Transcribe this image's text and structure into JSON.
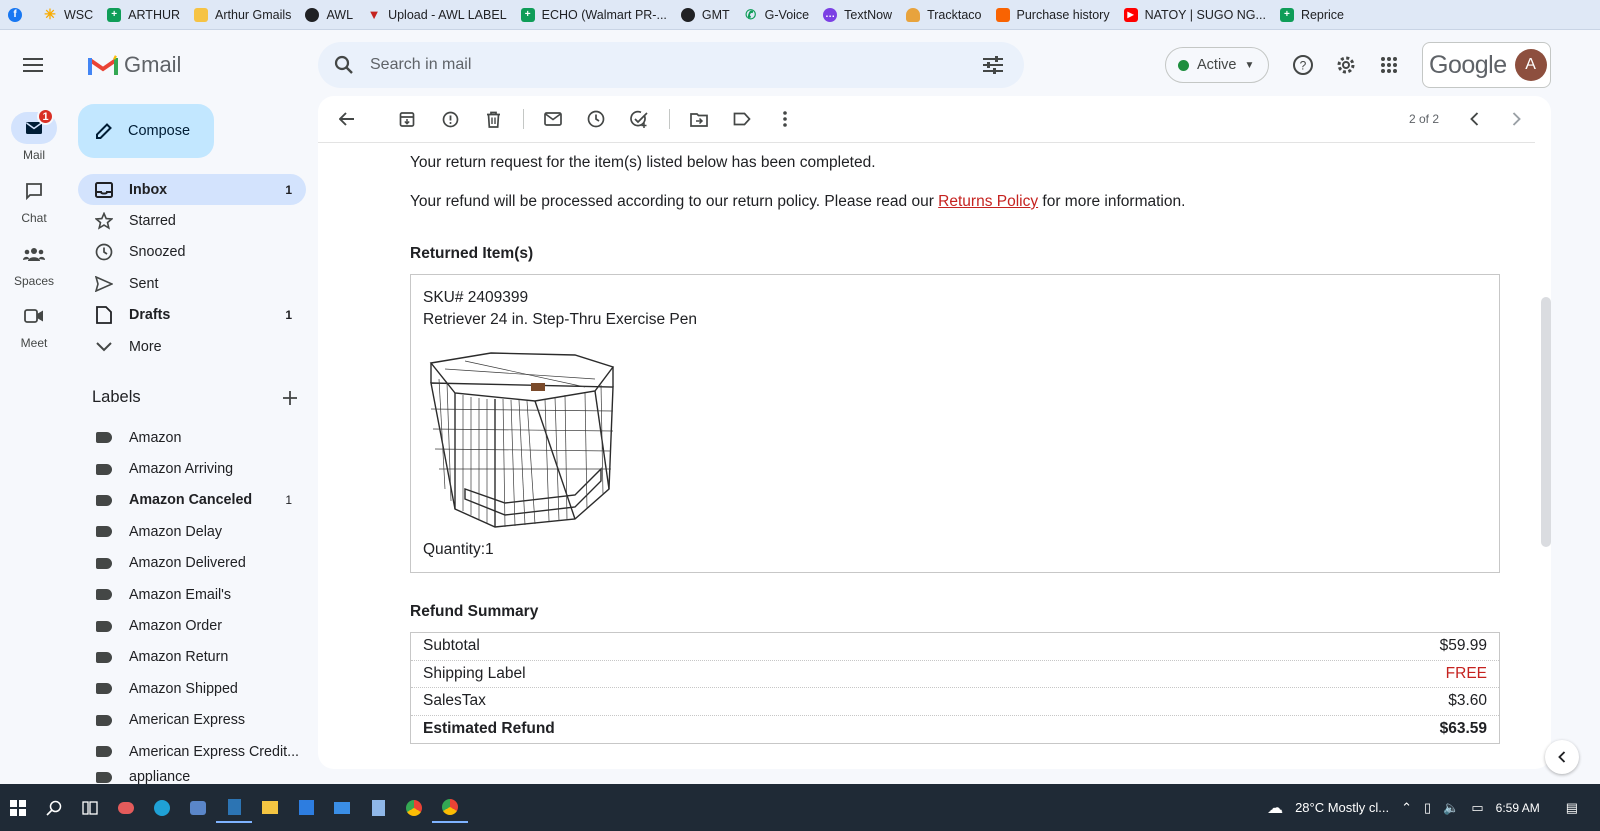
{
  "bookmarks": [
    {
      "label": "",
      "icon": "facebook-icon",
      "color": "#1877f2"
    },
    {
      "label": "WSC",
      "icon": "spark-icon",
      "color": "#f9ab00"
    },
    {
      "label": "ARTHUR",
      "icon": "sheets-icon",
      "color": "#0f9d58"
    },
    {
      "label": "Arthur Gmails",
      "icon": "folder-icon",
      "color": "#f6c344"
    },
    {
      "label": "AWL",
      "icon": "globe-icon",
      "color": "#202124"
    },
    {
      "label": "Upload - AWL LABEL",
      "icon": "shield-icon",
      "color": "#c5221f"
    },
    {
      "label": "ECHO (Walmart PR-...",
      "icon": "sheets-icon",
      "color": "#0f9d58"
    },
    {
      "label": "GMT",
      "icon": "globe-icon",
      "color": "#202124"
    },
    {
      "label": "G-Voice",
      "icon": "phone-icon",
      "color": "#0f9d58"
    },
    {
      "label": "TextNow",
      "icon": "chat-bubble-icon",
      "color": "#7b3fe4"
    },
    {
      "label": "Tracktaco",
      "icon": "taco-icon",
      "color": "#e8a33d"
    },
    {
      "label": "Purchase history",
      "icon": "store-icon",
      "color": "#f96302"
    },
    {
      "label": "NATOY | SUGO NG...",
      "icon": "youtube-icon",
      "color": "#ff0000"
    },
    {
      "label": "Reprice",
      "icon": "sheets-icon",
      "color": "#0f9d58"
    }
  ],
  "rail": {
    "mail": {
      "label": "Mail",
      "badge": "1"
    },
    "chat": {
      "label": "Chat"
    },
    "spaces": {
      "label": "Spaces"
    },
    "meet": {
      "label": "Meet"
    }
  },
  "header": {
    "app_name": "Gmail",
    "search_placeholder": "Search in mail",
    "status": "Active",
    "google_word": "Google",
    "avatar_letter": "A"
  },
  "sidebar": {
    "compose": "Compose",
    "nav": [
      {
        "label": "Inbox",
        "count": "1"
      },
      {
        "label": "Starred",
        "count": ""
      },
      {
        "label": "Snoozed",
        "count": ""
      },
      {
        "label": "Sent",
        "count": ""
      },
      {
        "label": "Drafts",
        "count": "1"
      },
      {
        "label": "More",
        "count": ""
      }
    ],
    "labels_title": "Labels",
    "labels": [
      {
        "label": "Amazon",
        "count": ""
      },
      {
        "label": "Amazon Arriving",
        "count": ""
      },
      {
        "label": "Amazon Canceled",
        "count": "1"
      },
      {
        "label": "Amazon Delay",
        "count": ""
      },
      {
        "label": "Amazon Delivered",
        "count": ""
      },
      {
        "label": "Amazon Email's",
        "count": ""
      },
      {
        "label": "Amazon Order",
        "count": ""
      },
      {
        "label": "Amazon Return",
        "count": ""
      },
      {
        "label": "Amazon Shipped",
        "count": ""
      },
      {
        "label": "American Express",
        "count": ""
      },
      {
        "label": "American Express Credit...",
        "count": ""
      },
      {
        "label": "appliance",
        "count": ""
      }
    ]
  },
  "toolbar": {
    "pager": "2 of 2"
  },
  "email": {
    "line1": "Your return request for the item(s) listed below has been completed.",
    "line2_before": "Your refund will be processed according to our return policy. Please read our ",
    "line2_link": "Returns Policy",
    "line2_after": " for more information.",
    "returned_title": "Returned Item(s)",
    "sku": "SKU# 2409399",
    "item_name": "Retriever 24 in. Step-Thru Exercise Pen",
    "quantity": "Quantity:1",
    "summary_title": "Refund Summary",
    "summary": [
      {
        "label": "Subtotal",
        "value": "$59.99"
      },
      {
        "label": "Shipping Label",
        "value": "FREE"
      },
      {
        "label": "SalesTax",
        "value": "$3.60"
      },
      {
        "label": "Estimated Refund",
        "value": "$63.59"
      }
    ]
  },
  "taskbar": {
    "weather": "28°C  Mostly cl...",
    "time": "6:59 AM"
  },
  "colors": {
    "accent": "#0b57d0",
    "compose_bg": "#c2e7ff",
    "active_nav": "#d3e3fd",
    "link_red": "#c5221f"
  }
}
